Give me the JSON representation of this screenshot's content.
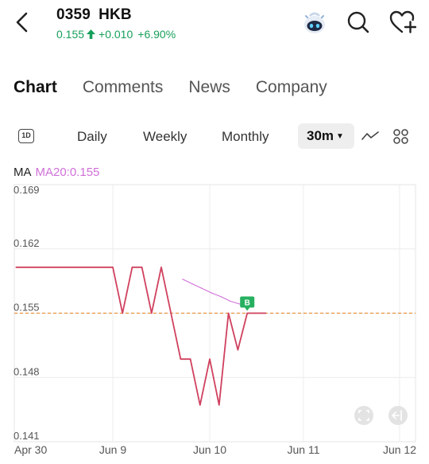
{
  "header": {
    "symbol": "0359",
    "market": "HKB",
    "price": "0.155",
    "change": "+0.010",
    "change_pct": "+6.90%",
    "up_color": "#16a05a"
  },
  "icons": {
    "back": "back-arrow-icon",
    "assistant": "robot-icon",
    "search": "search-icon",
    "favorite": "heart-add-icon"
  },
  "tabs": [
    {
      "label": "Chart",
      "active": true
    },
    {
      "label": "Comments",
      "active": false
    },
    {
      "label": "News",
      "active": false
    },
    {
      "label": "Company",
      "active": false
    }
  ],
  "periods": {
    "one_day": "1D",
    "daily": "Daily",
    "weekly": "Weekly",
    "monthly": "Monthly",
    "selected": "30m"
  },
  "indicators": {
    "label": "MA",
    "ma20": "MA20:0.155",
    "ma20_color": "#d070d8"
  },
  "chart_data": {
    "type": "line",
    "y_ticks": [
      "0.169",
      "0.162",
      "0.155",
      "0.148",
      "0.141"
    ],
    "ylim": [
      0.141,
      0.169
    ],
    "x_ticks": [
      "Apr 30",
      "Jun 9",
      "Jun 10",
      "Jun 11",
      "Jun 12"
    ],
    "grid": true,
    "current_price": 0.155,
    "current_price_color": "#e8923a",
    "series": [
      {
        "color": "#d0405e",
        "x": [
          0,
          1,
          1.1,
          1.2,
          1.3,
          1.4,
          1.5,
          1.6,
          1.7,
          1.8,
          1.9,
          2.0,
          2.1,
          2.2,
          2.3,
          2.4,
          2.5,
          2.6
        ],
        "values": [
          0.16,
          0.16,
          0.155,
          0.16,
          0.16,
          0.155,
          0.16,
          0.155,
          0.15,
          0.15,
          0.145,
          0.15,
          0.145,
          0.155,
          0.151,
          0.155,
          0.155,
          0.155
        ]
      },
      {
        "name": "MA20",
        "color": "#d070d8",
        "x": [
          1.72,
          1.82,
          1.92,
          2.02,
          2.12,
          2.22,
          2.32,
          2.4
        ],
        "values": [
          0.1587,
          0.1582,
          0.1577,
          0.1572,
          0.1568,
          0.1563,
          0.156,
          0.1557
        ]
      }
    ],
    "marker": {
      "label": "B",
      "x": 2.4,
      "value": 0.155,
      "color": "#27b060"
    }
  }
}
